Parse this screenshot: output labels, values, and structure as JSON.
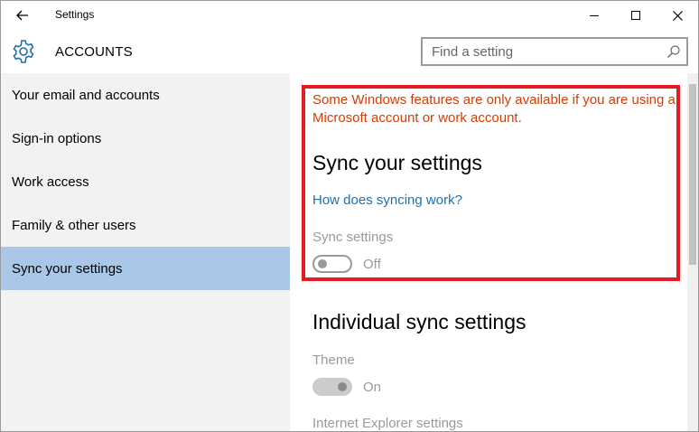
{
  "window": {
    "title": "Settings"
  },
  "header": {
    "title": "ACCOUNTS",
    "search_placeholder": "Find a setting"
  },
  "sidebar": {
    "items": [
      {
        "label": "Your email and accounts"
      },
      {
        "label": "Sign-in options"
      },
      {
        "label": "Work access"
      },
      {
        "label": "Family & other users"
      },
      {
        "label": "Sync your settings",
        "selected": true
      }
    ]
  },
  "main": {
    "notice": "Some Windows features are only available if you are using a Microsoft account or work account.",
    "sync_heading": "Sync your settings",
    "sync_link": "How does syncing work?",
    "sync_settings_label": "Sync settings",
    "sync_settings_state": "Off",
    "individual_heading": "Individual sync settings",
    "theme_label": "Theme",
    "theme_state": "On",
    "ie_label": "Internet Explorer settings"
  },
  "colors": {
    "accent": "#1f6fab",
    "selected_bg": "#a9c7e7",
    "warning_text": "#d83b01",
    "highlight_border": "#e31b23"
  },
  "icons": {
    "back": "back-arrow-icon",
    "gear": "gear-icon",
    "search": "search-icon",
    "minimize": "minimize-icon",
    "maximize": "maximize-icon",
    "close": "close-icon"
  }
}
